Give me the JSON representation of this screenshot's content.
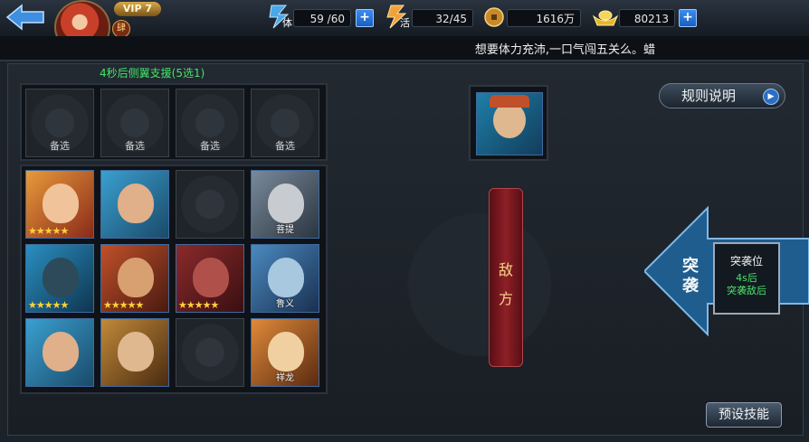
{
  "header": {
    "vip": "VIP 7",
    "rank_badge": "肆",
    "stamina": {
      "label": "体",
      "value": "59 /60"
    },
    "energy": {
      "label": "活",
      "value": "32/45"
    },
    "coins": {
      "value": "1616万"
    },
    "gold": {
      "value": "80213"
    },
    "notice": "想要体力充沛,一口气闯五关么。蜡"
  },
  "support": {
    "title": "4秒后侧翼支援(5选1)",
    "slots": [
      "备选",
      "备选",
      "备选",
      "备选"
    ]
  },
  "heroes": [
    {
      "stars": "★★★★★",
      "name": ""
    },
    {
      "stars": "",
      "name": ""
    },
    {
      "stars": "",
      "name": ""
    },
    {
      "stars": "",
      "name": "菩提"
    },
    {
      "stars": "★★★★★",
      "name": ""
    },
    {
      "stars": "★★★★★",
      "name": ""
    },
    {
      "stars": "★★★★★",
      "name": ""
    },
    {
      "stars": "",
      "name": "鲁义"
    },
    {
      "stars": "",
      "name": ""
    },
    {
      "stars": "",
      "name": ""
    },
    {
      "stars": "",
      "name": ""
    },
    {
      "stars": "",
      "name": "祥龙"
    }
  ],
  "rules_button": "规则说明",
  "enemy_banner": {
    "line1": "敌",
    "line2": "方"
  },
  "raid": {
    "label_top": "突",
    "label_bottom": "袭",
    "card_title": "突袭位",
    "card_line1": "4s后",
    "card_line2": "突袭敌后"
  },
  "preset_button": "预设技能",
  "colors": {
    "accent_green": "#45e36a",
    "enemy_red": "#8e1f27",
    "plus_blue": "#2b6fc4"
  }
}
